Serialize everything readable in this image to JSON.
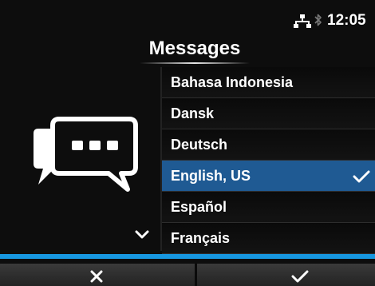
{
  "status_bar": {
    "time": "12:05",
    "network_icon": "network-icon",
    "bluetooth_icon": "bluetooth-icon"
  },
  "header": {
    "title": "Messages"
  },
  "left_panel": {
    "icon": "chat-bubbles-icon",
    "scroll_indicator": "chevron-down-icon"
  },
  "language_list": {
    "items": [
      {
        "label": "Bahasa Indonesia",
        "selected": false
      },
      {
        "label": "Dansk",
        "selected": false
      },
      {
        "label": "Deutsch",
        "selected": false
      },
      {
        "label": "English, US",
        "selected": true
      },
      {
        "label": "Español",
        "selected": false
      },
      {
        "label": "Français",
        "selected": false
      }
    ]
  },
  "button_bar": {
    "cancel_icon": "close-icon",
    "ok_icon": "check-icon"
  },
  "colors": {
    "background": "#0d0d0d",
    "selection": "#1f5a93",
    "accent_bar": "#1797e0",
    "text": "#ffffff"
  }
}
